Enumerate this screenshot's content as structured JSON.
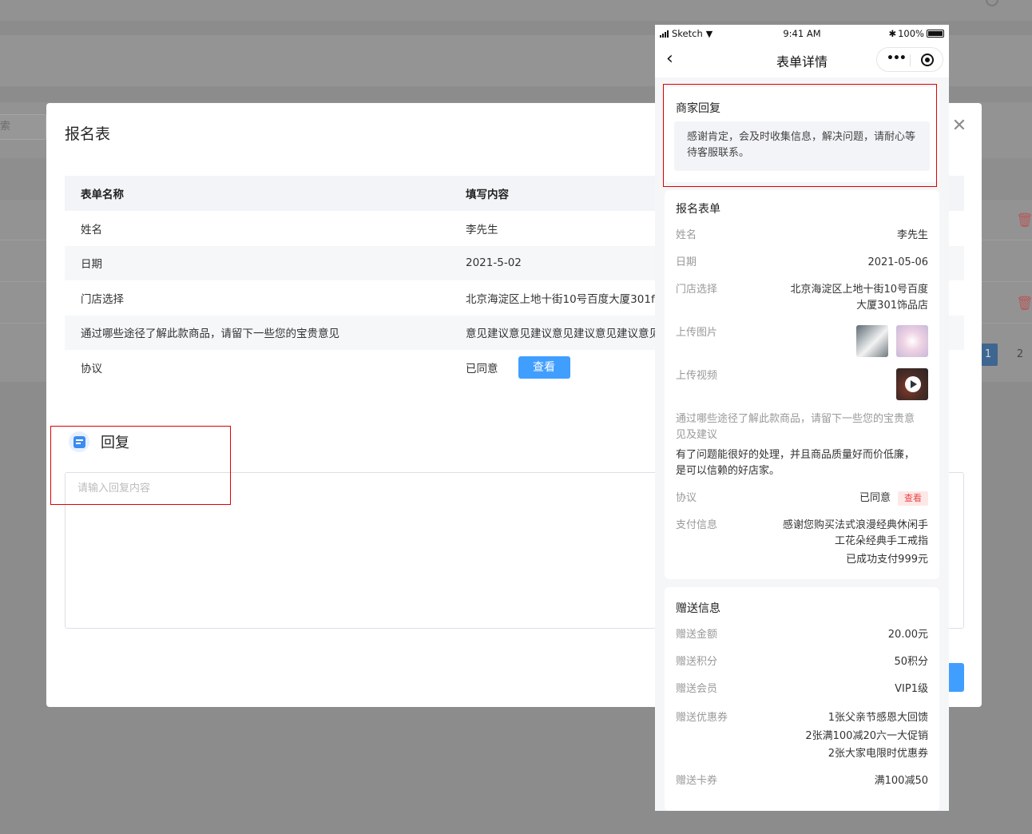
{
  "background": {
    "search_placeholder": "索",
    "pagination": [
      "1",
      "2"
    ]
  },
  "modal": {
    "title": "报名表",
    "close_icon": "close-icon",
    "table": {
      "headers": [
        "表单名称",
        "填写内容"
      ],
      "rows": [
        {
          "name": "姓名",
          "value": "李先生"
        },
        {
          "name": "日期",
          "value": "2021-5-02"
        },
        {
          "name": "门店选择",
          "value": "北京海淀区上地十街10号百度大厦301f"
        },
        {
          "name": "通过哪些途径了解此款商品，请留下一些您的宝贵意见",
          "value": "意见建议意见建议意见建议意见建议意见"
        },
        {
          "name": "协议",
          "value": "已同意",
          "button": "查看"
        }
      ]
    },
    "reply": {
      "title": "回复",
      "placeholder": "请输入回复内容"
    }
  },
  "phone": {
    "status": {
      "carrier": "Sketch",
      "time": "9:41 AM",
      "battery": "100%"
    },
    "nav_title": "表单详情",
    "merchant_reply": {
      "title": "商家回复",
      "content": "感谢肯定，会及时收集信息，解决问题，请耐心等待客服联系。"
    },
    "signup_form": {
      "title": "报名表单",
      "name_label": "姓名",
      "name_value": "李先生",
      "date_label": "日期",
      "date_value": "2021-05-06",
      "store_label": "门店选择",
      "store_value_1": "北京海淀区上地十街10号百度",
      "store_value_2": "大厦301饰品店",
      "image_label": "上传图片",
      "video_label": "上传视频",
      "question_label_1": "通过哪些途径了解此款商品，请留下一些您的宝贵意",
      "question_label_2": "见及建议",
      "question_answer_1": "有了问题能很好的处理，并且商品质量好而价低廉，",
      "question_answer_2": "是可以信赖的好店家。",
      "agreement_label": "协议",
      "agreement_value": "已同意",
      "agreement_tag": "查看",
      "pay_label": "支付信息",
      "pay_value_1": "感谢您购买法式浪漫经典休闲手",
      "pay_value_2": "工花朵经典手工戒指",
      "pay_value_3": "已成功支付999元"
    },
    "gift": {
      "title": "赠送信息",
      "amount_label": "赠送金额",
      "amount_value": "20.00元",
      "points_label": "赠送积分",
      "points_value": "50积分",
      "member_label": "赠送会员",
      "member_value": "VIP1级",
      "coupon_label": "赠送优惠券",
      "coupon_1": "1张父亲节感恩大回馈",
      "coupon_2": "2张满100减20六一大促销",
      "coupon_3": "2张大家电限时优惠券",
      "card_label": "赠送卡券",
      "card_value": "满100减50"
    }
  }
}
